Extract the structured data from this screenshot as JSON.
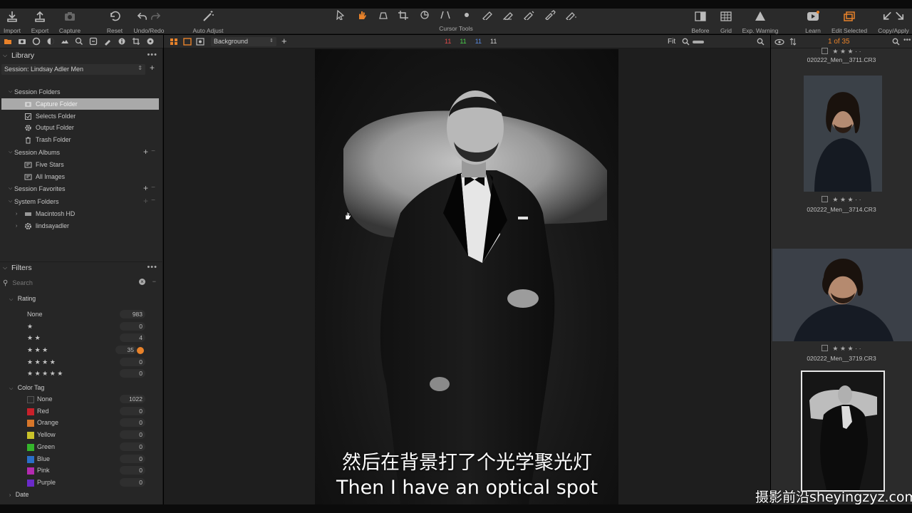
{
  "toolbar": {
    "import": "Import",
    "export": "Export",
    "capture": "Capture",
    "reset": "Reset",
    "undo_redo": "Undo/Redo",
    "auto_adjust": "Auto Adjust",
    "cursor_tools": "Cursor Tools",
    "before": "Before",
    "grid": "Grid",
    "exp_warning": "Exp. Warning",
    "learn": "Learn",
    "edit_selected": "Edit Selected",
    "copy_apply": "Copy/Apply"
  },
  "library": {
    "title": "Library",
    "session": "Session: Lindsay Adler Men",
    "session_folders": {
      "label": "Session Folders",
      "items": [
        "Capture Folder",
        "Selects Folder",
        "Output Folder",
        "Trash Folder"
      ]
    },
    "session_albums": {
      "label": "Session Albums",
      "items": [
        "Five Stars",
        "All Images"
      ]
    },
    "session_favorites": "Session Favorites",
    "system_folders": {
      "label": "System Folders",
      "items": [
        "Macintosh HD",
        "lindsayadler"
      ]
    }
  },
  "filters": {
    "title": "Filters",
    "search_placeholder": "Search",
    "rating": {
      "label": "Rating",
      "rows": [
        {
          "name": "None",
          "count": "983"
        },
        {
          "name": "★",
          "count": "0"
        },
        {
          "name": "★ ★",
          "count": "4"
        },
        {
          "name": "★ ★ ★",
          "count": "35"
        },
        {
          "name": "★ ★ ★ ★",
          "count": "0"
        },
        {
          "name": "★ ★ ★ ★ ★",
          "count": "0"
        }
      ]
    },
    "color_tag": {
      "label": "Color Tag",
      "rows": [
        {
          "name": "None",
          "count": "1022",
          "color": "#2a2a2a"
        },
        {
          "name": "Red",
          "count": "0",
          "color": "#c8202a"
        },
        {
          "name": "Orange",
          "count": "0",
          "color": "#d7762a"
        },
        {
          "name": "Yellow",
          "count": "0",
          "color": "#c9c22a"
        },
        {
          "name": "Green",
          "count": "0",
          "color": "#35b52c"
        },
        {
          "name": "Blue",
          "count": "0",
          "color": "#2a6fc9"
        },
        {
          "name": "Pink",
          "count": "0",
          "color": "#b32ab0"
        },
        {
          "name": "Purple",
          "count": "0",
          "color": "#6a2ac9"
        }
      ]
    },
    "date": "Date"
  },
  "viewer": {
    "background": "Background",
    "clip_nums": [
      "11",
      "11",
      "11",
      "11"
    ],
    "clip_colors": [
      "#e14b4b",
      "#4bd14b",
      "#5a8ae1",
      "#cfcfcf"
    ],
    "zoom": "Fit"
  },
  "browser": {
    "counter": "1 of 35",
    "thumbs": [
      {
        "caption": "020222_Men__3711.CR3",
        "rating": "★ ★ ★ · ·"
      },
      {
        "caption": "020222_Men__3714.CR3",
        "rating": "★ ★ ★ · ·"
      },
      {
        "caption": "020222_Men__3719.CR3",
        "rating": "★ ★ ★ · ·"
      }
    ]
  },
  "subtitles": {
    "chinese": "然后在背景打了个光学聚光灯",
    "english": "Then I have an optical spot"
  },
  "watermark": "摄影前沿sheyingzyz.com",
  "colors": {
    "accent": "#e8822a",
    "panel": "#262626",
    "selected_row": "#a9a9a9"
  }
}
